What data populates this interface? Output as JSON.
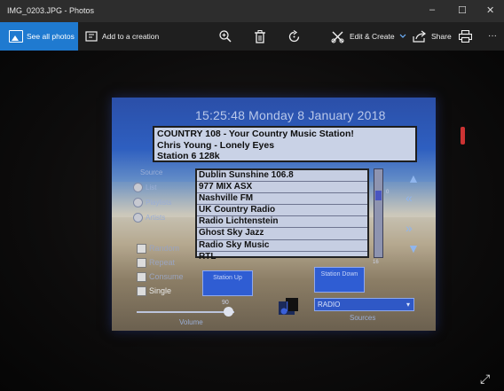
{
  "window": {
    "title": "IMG_0203.JPG - Photos",
    "minimize_glyph": "–",
    "maximize_glyph": "☐",
    "close_glyph": "✕"
  },
  "toolbar": {
    "see_all": "See all photos",
    "add_to_creation": "Add to a creation",
    "edit_create": "Edit & Create",
    "share": "Share",
    "more_glyph": "···",
    "icons": [
      "image-icon",
      "add-creation-icon",
      "zoom-icon",
      "delete-icon",
      "rotate-icon",
      "edit-icon",
      "chevron-down-icon",
      "share-icon",
      "print-icon",
      "more-icon"
    ],
    "accent_color": "#1f7ad0"
  },
  "photo": {
    "clock": "15:25:48 Monday  8 January 2018",
    "info_lines": [
      "COUNTRY 108 - Your Country Music Station!",
      "Chris Young - Lonely Eyes",
      "Station 6 128k"
    ],
    "source_label": "Source",
    "radio_options": [
      "List",
      "Playlists",
      "Artists"
    ],
    "stations": [
      "Dublin Sunshine 106.8",
      "977 MIX ASX",
      "Nashville FM",
      "UK Country Radio",
      "Radio Lichtenstein",
      "Ghost Sky Jazz",
      "Radio Sky Music",
      "RTL"
    ],
    "scroll_min": "0",
    "scroll_max": "16",
    "checkboxes": [
      "Random",
      "Repeat",
      "Consume",
      "Single"
    ],
    "station_up": "Station Up",
    "station_down": "Station Down",
    "volume_label": "Volume",
    "volume_value": "90",
    "volume_level_percent": 90,
    "source_select_value": "RADIO",
    "sources_label": "Sources"
  }
}
